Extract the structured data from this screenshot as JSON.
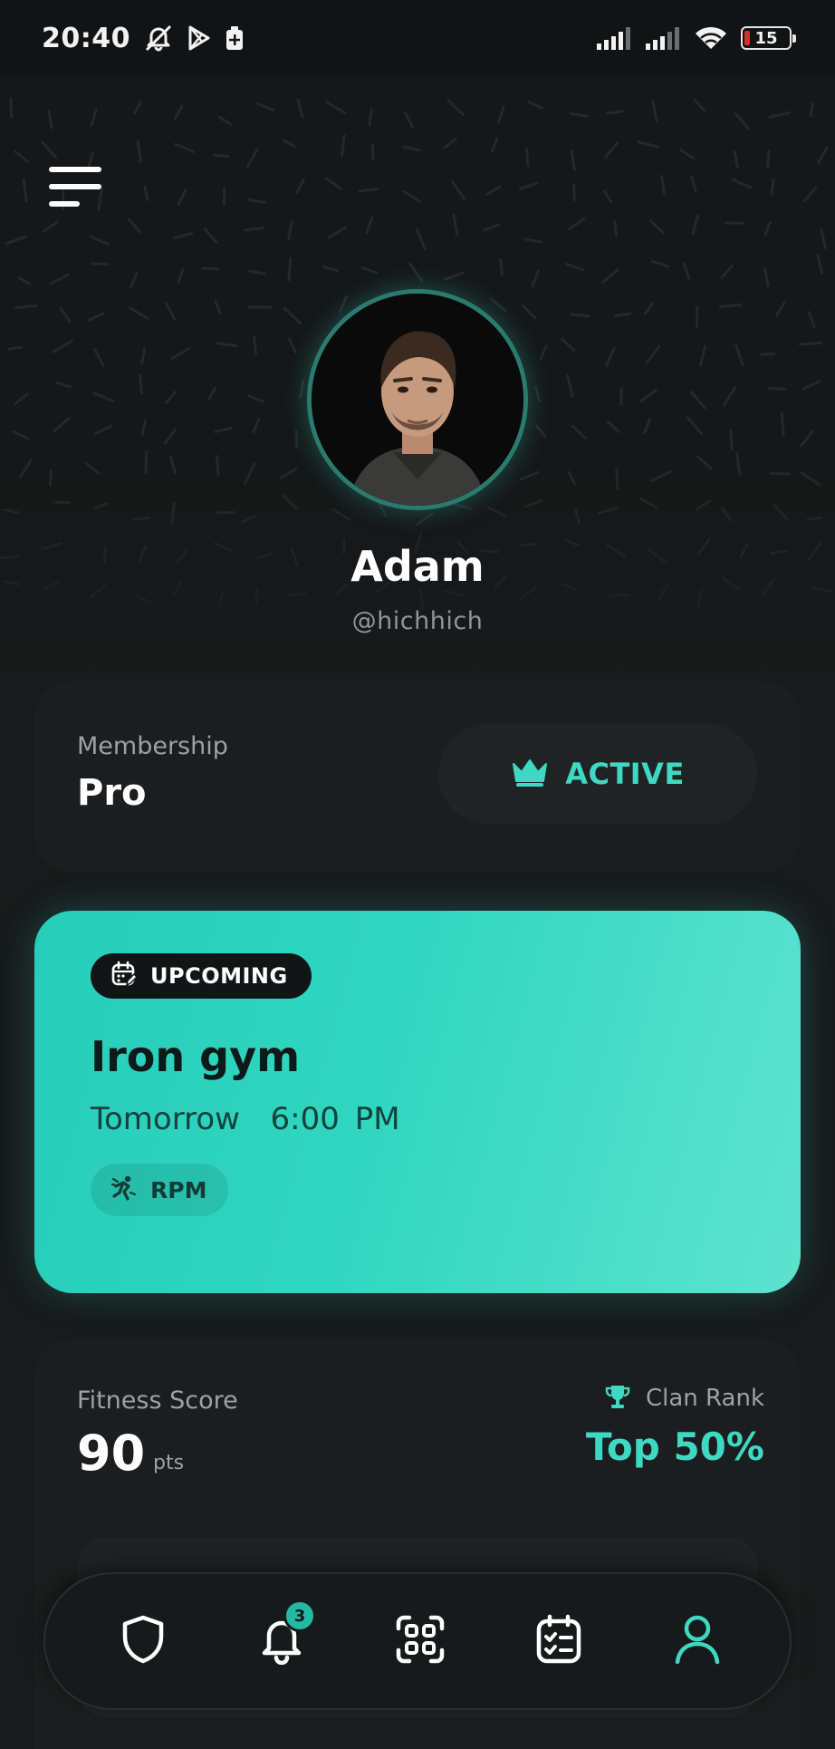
{
  "status_bar": {
    "time": "20:40",
    "battery": "15",
    "icons": [
      "mute-alarm-icon",
      "play-store-icon",
      "battery-saver-icon",
      "signal-icon",
      "signal-icon",
      "wifi-icon",
      "battery-icon"
    ]
  },
  "profile": {
    "name": "Adam",
    "handle": "@hichhich"
  },
  "membership": {
    "label": "Membership",
    "value": "Pro",
    "status": "ACTIVE",
    "status_icon": "crown-icon"
  },
  "upcoming": {
    "badge": "UPCOMING",
    "badge_icon": "calendar-edit-icon",
    "title": "Iron gym",
    "time": "Tomorrow  6:00 PM",
    "tag": "RPM",
    "tag_icon": "cycling-icon"
  },
  "fitness": {
    "label": "Fitness Score",
    "value": "90",
    "unit": "pts",
    "rank_label": "Clan Rank",
    "rank_value": "Top 50%",
    "rank_icon": "trophy-icon"
  },
  "nav": {
    "items": [
      {
        "icon": "shield-icon"
      },
      {
        "icon": "bell-icon",
        "badge": "3"
      },
      {
        "icon": "qr-scan-icon"
      },
      {
        "icon": "task-list-icon"
      },
      {
        "icon": "profile-icon"
      }
    ]
  },
  "colors": {
    "background": "#181a1b",
    "accent": "#3fd8c2",
    "card": "#1b1d1e",
    "upcoming_card": "#31d6c0"
  }
}
